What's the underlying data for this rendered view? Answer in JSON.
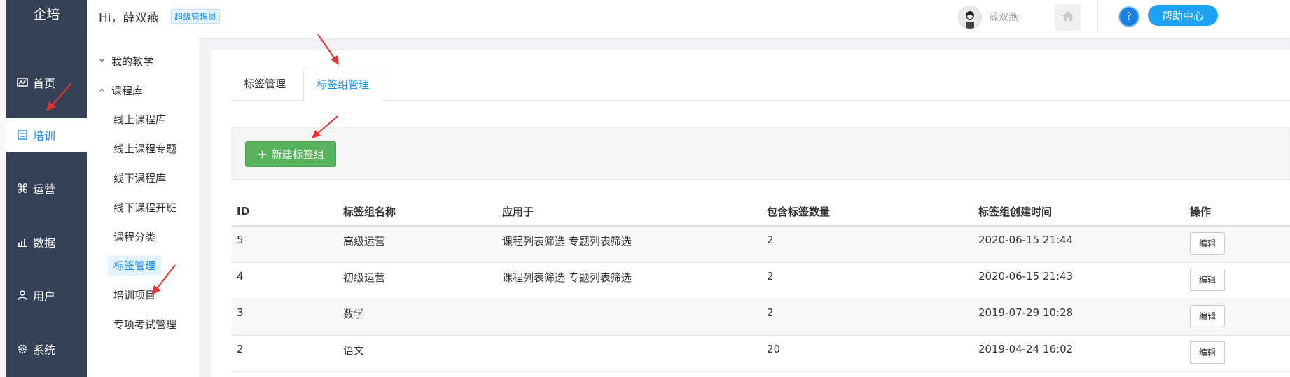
{
  "app": {
    "logo": "企培"
  },
  "nav": {
    "items": [
      {
        "label": "首页",
        "icon": "dashboard-icon",
        "active": false
      },
      {
        "label": "培训",
        "icon": "book-icon",
        "active": true
      },
      {
        "label": "运营",
        "icon": "command-icon",
        "active": false
      },
      {
        "label": "数据",
        "icon": "chart-icon",
        "active": false
      },
      {
        "label": "用户",
        "icon": "user-icon",
        "active": false
      },
      {
        "label": "系统",
        "icon": "gear-icon",
        "active": false
      }
    ]
  },
  "header": {
    "greeting": "Hi，薛双燕",
    "role": "超级管理员",
    "username": "薛双燕",
    "help_label": "帮助中心",
    "help_icon": "?"
  },
  "subnav": {
    "group1": "我的教学",
    "group2": "课程库",
    "items": [
      "线上课程库",
      "线上课程专题",
      "线下课程库",
      "线下课程开班",
      "课程分类",
      "标签管理",
      "培训项目",
      "专项考试管理"
    ],
    "active_index": 5
  },
  "tabs": [
    {
      "label": "标签管理",
      "active": false
    },
    {
      "label": "标签组管理",
      "active": true
    }
  ],
  "toolbar": {
    "new_label": "新建标签组",
    "new_icon": "+"
  },
  "table": {
    "columns": [
      "ID",
      "标签组名称",
      "应用于",
      "包含标签数量",
      "标签组创建时间",
      "操作"
    ],
    "rows": [
      {
        "id": "5",
        "name": "高级运营",
        "applied": "课程列表筛选 专题列表筛选",
        "count": "2",
        "created": "2020-06-15 21:44",
        "action": "编辑"
      },
      {
        "id": "4",
        "name": "初级运营",
        "applied": "课程列表筛选 专题列表筛选",
        "count": "2",
        "created": "2020-06-15 21:43",
        "action": "编辑"
      },
      {
        "id": "3",
        "name": "数学",
        "applied": "",
        "count": "2",
        "created": "2019-07-29 10:28",
        "action": "编辑"
      },
      {
        "id": "2",
        "name": "语文",
        "applied": "",
        "count": "20",
        "created": "2019-04-24 16:02",
        "action": "编辑"
      }
    ]
  },
  "colors": {
    "accent": "#1890ff",
    "sidebar": "#344156",
    "green": "#56b25c",
    "annotation": "#e8322f"
  }
}
